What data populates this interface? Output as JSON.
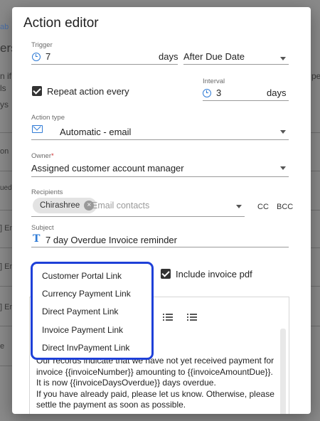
{
  "background": {
    "fragments": [
      "ab",
      "ers",
      "n if",
      "ls",
      "ys",
      "on",
      "ued",
      "] En",
      "] En",
      "] En",
      "e",
      "pet"
    ]
  },
  "modal": {
    "title": "Action editor",
    "trigger": {
      "label": "Trigger",
      "value": "7",
      "unit": "days",
      "relation": "After Due Date"
    },
    "repeat": {
      "label": "Repeat action every",
      "checked": true
    },
    "interval": {
      "label": "Interval",
      "value": "3",
      "unit": "days"
    },
    "action_type": {
      "label": "Action type",
      "value": "Automatic - email"
    },
    "owner": {
      "label": "Owner",
      "required_mark": "*",
      "value": "Assigned customer account manager"
    },
    "recipients": {
      "label": "Recipients",
      "chip": "Chirashree",
      "placeholder": "Email contacts",
      "cc": "CC",
      "bcc": "BCC"
    },
    "subject": {
      "label": "Subject",
      "value": "7 day Overdue Invoice reminder"
    },
    "include_pdf": {
      "label": "Include invoice pdf",
      "checked": true
    },
    "dropdown_items": [
      "Customer Portal Link",
      "Currency Payment Link",
      "Direct Payment Link",
      "Invoice Payment Link",
      "Direct InvPayment Link"
    ],
    "body_lines": [
      "Our records indicate that we have not yet received payment for",
      "invoice {{invoiceNumber}} amounting to {{invoiceAmountDue}}.",
      "It is now {{invoiceDaysOverdue}} days overdue.",
      "If you have already paid, please let us know. Otherwise, please",
      "settle the payment as soon as possible."
    ]
  },
  "colors": {
    "accent": "#2f7bd6",
    "highlight": "#1e40d8"
  }
}
